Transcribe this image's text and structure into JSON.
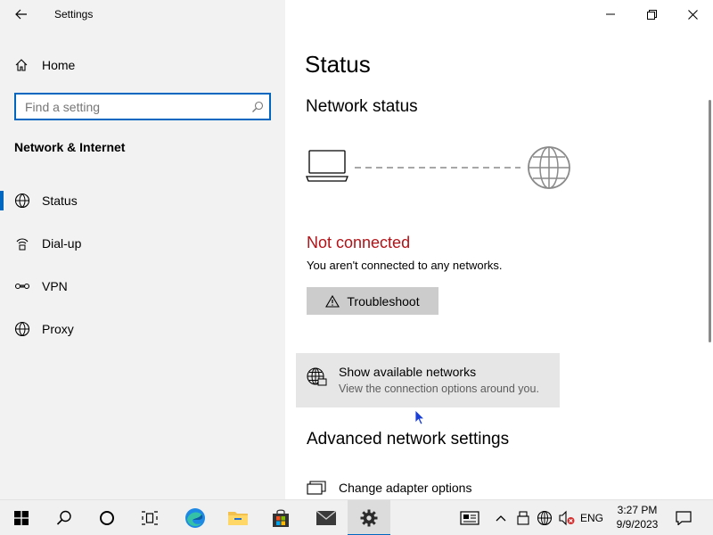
{
  "app": {
    "title": "Settings"
  },
  "window_controls": {
    "minimize_icon": "minimize-icon",
    "maximize_icon": "restore-icon",
    "close_icon": "close-icon"
  },
  "sidebar": {
    "home_label": "Home",
    "search_placeholder": "Find a setting",
    "section_title": "Network & Internet",
    "items": [
      {
        "label": "Status",
        "icon": "status-icon",
        "selected": true
      },
      {
        "label": "Dial-up",
        "icon": "dialup-icon",
        "selected": false
      },
      {
        "label": "VPN",
        "icon": "vpn-icon",
        "selected": false
      },
      {
        "label": "Proxy",
        "icon": "proxy-icon",
        "selected": false
      }
    ]
  },
  "main": {
    "page_title": "Status",
    "network_status_heading": "Network status",
    "connection_state": "Not connected",
    "connection_description": "You aren't connected to any networks.",
    "troubleshoot_label": "Troubleshoot",
    "show_networks": {
      "title": "Show available networks",
      "subtitle": "View the connection options around you."
    },
    "advanced_heading": "Advanced network settings",
    "adapter_label": "Change adapter options"
  },
  "taskbar": {
    "apps": [
      "start",
      "search",
      "cortana",
      "task-view",
      "edge",
      "file-explorer",
      "store",
      "mail",
      "settings"
    ],
    "language": "ENG",
    "time": "3:27 PM",
    "date": "9/9/2023"
  },
  "colors": {
    "accent": "#0067c0",
    "error": "#b31217",
    "sidebar_bg": "#f2f2f2",
    "taskbar_bg": "#f0f0f0"
  }
}
